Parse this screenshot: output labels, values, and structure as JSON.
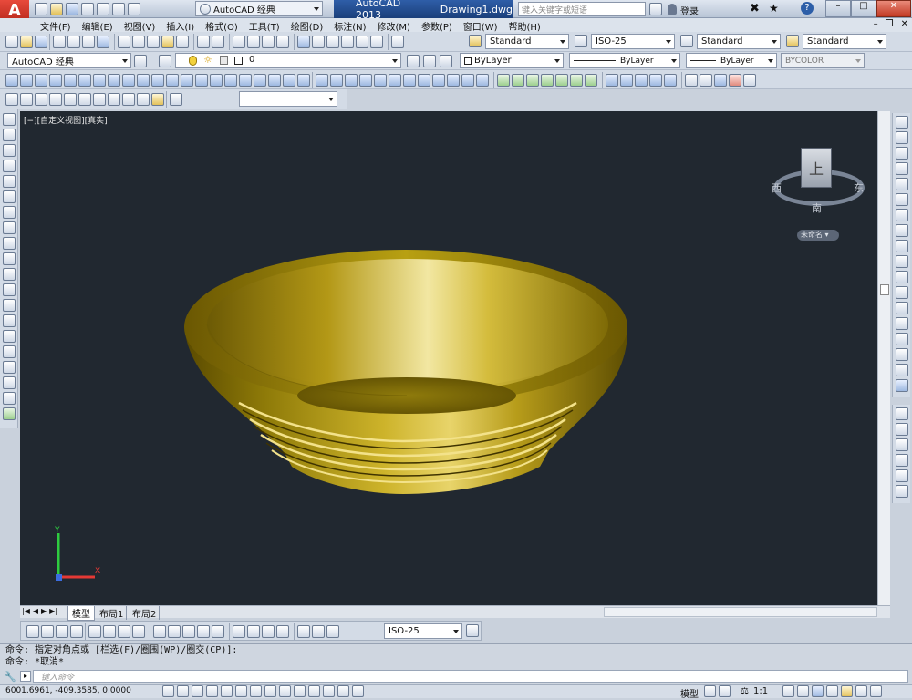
{
  "title_bar": {
    "workspace": "AutoCAD 经典",
    "app_name": "AutoCAD 2013",
    "drawing": "Drawing1.dwg",
    "search_placeholder": "键入关键字或短语",
    "login": "登录"
  },
  "menu": [
    "文件(F)",
    "编辑(E)",
    "视图(V)",
    "插入(I)",
    "格式(O)",
    "工具(T)",
    "绘图(D)",
    "标注(N)",
    "修改(M)",
    "参数(P)",
    "窗口(W)",
    "帮助(H)"
  ],
  "toolbar1": {
    "text_style": "Standard",
    "dim_style": "ISO-25",
    "table_style": "Standard",
    "mleader_style": "Standard"
  },
  "toolbar2": {
    "workspace": "AutoCAD 经典",
    "layer": "0",
    "color": "ByLayer",
    "linetype": "ByLayer",
    "lineweight": "ByLayer",
    "plotstyle": "BYCOLOR"
  },
  "viewport": {
    "label": "[−][自定义视图][真实]",
    "background": "#212830"
  },
  "viewcube": {
    "top": "上",
    "south": "南",
    "west": "西",
    "east": "东",
    "wcs": "未命名"
  },
  "layout_tabs": [
    "模型",
    "布局1",
    "布局2"
  ],
  "dim_toolbar": {
    "dim_style": "ISO-25"
  },
  "command": {
    "history_1": "命令: 指定对角点或 [栏选(F)/圈围(WP)/圈交(CP)]:",
    "history_2": "命令: *取消*",
    "prompt_placeholder": "键入命令"
  },
  "status": {
    "coordinates": "6001.6961, -409.3585, 0.0000",
    "model": "模型",
    "scale": "1:1"
  },
  "colors": {
    "accent": "#c8a400",
    "bowl_gold": "#b89a12"
  }
}
